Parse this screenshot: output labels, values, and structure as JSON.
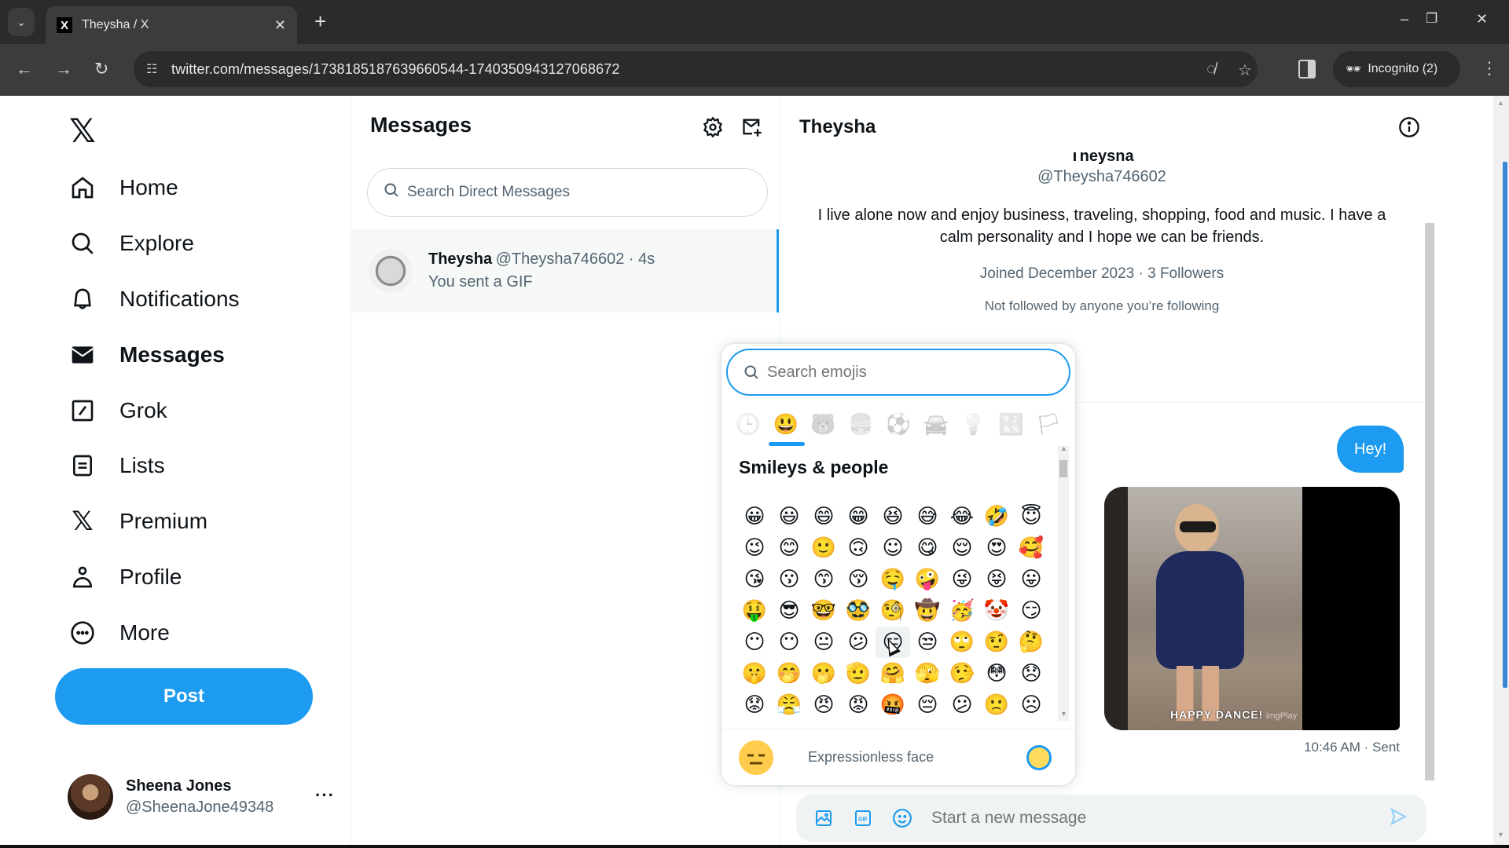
{
  "browser": {
    "tab_title": "Theysha / X",
    "tab_favicon": "X",
    "new_tab": "+",
    "url": "twitter.com/messages/1738185187639660544-1740350943127068672",
    "incognito_label": "Incognito (2)",
    "window_controls": {
      "minimize": "–",
      "restore": "❐",
      "close": "✕"
    }
  },
  "sidebar": {
    "logo": "𝕏",
    "items": [
      {
        "label": "Home",
        "icon": "home-icon"
      },
      {
        "label": "Explore",
        "icon": "search-icon"
      },
      {
        "label": "Notifications",
        "icon": "bell-icon"
      },
      {
        "label": "Messages",
        "icon": "envelope-icon",
        "active": true
      },
      {
        "label": "Grok",
        "icon": "grok-icon"
      },
      {
        "label": "Lists",
        "icon": "list-icon"
      },
      {
        "label": "Premium",
        "icon": "x-logo-icon"
      },
      {
        "label": "Profile",
        "icon": "person-icon"
      },
      {
        "label": "More",
        "icon": "more-circle-icon"
      }
    ],
    "post_label": "Post",
    "account": {
      "name": "Sheena Jones",
      "handle": "@SheenaJone49348",
      "more": "···"
    }
  },
  "conversations": {
    "title": "Messages",
    "search_placeholder": "Search Direct Messages",
    "items": [
      {
        "name": "Theysha",
        "meta": "@Theysha746602 · 4s",
        "preview": "You sent a GIF"
      }
    ]
  },
  "chat": {
    "title": "Theysha",
    "profile": {
      "name": "Theysha",
      "handle": "@Theysha746602",
      "bio": "I live alone now and enjoy business, traveling, shopping, food and music. I have a calm personality and I hope we can be friends.",
      "joined": "Joined December 2023 · 3 Followers",
      "mutual": "Not followed by anyone you’re following"
    },
    "messages": [
      {
        "type": "text",
        "text": "Hey!"
      },
      {
        "type": "gif",
        "caption": "HAPPY DANCE!",
        "watermark": "imgPlay"
      }
    ],
    "status": "10:46 AM · Sent",
    "composer_placeholder": "Start a new message"
  },
  "emoji_picker": {
    "search_placeholder": "Search emojis",
    "categories": [
      {
        "name": "recent",
        "glyph": "🕒"
      },
      {
        "name": "smileys-people",
        "glyph": "😃",
        "active": true
      },
      {
        "name": "animals-nature",
        "glyph": "🐻"
      },
      {
        "name": "food-drink",
        "glyph": "🍔"
      },
      {
        "name": "activity",
        "glyph": "⚽"
      },
      {
        "name": "travel-places",
        "glyph": "🚘"
      },
      {
        "name": "objects",
        "glyph": "💡"
      },
      {
        "name": "symbols",
        "glyph": "🔣"
      },
      {
        "name": "flags",
        "glyph": "🏳"
      }
    ],
    "section_title": "Smileys & people",
    "emojis": [
      "😀",
      "😃",
      "😄",
      "😁",
      "😆",
      "😅",
      "😂",
      "🤣",
      "😇",
      "😉",
      "😊",
      "🙂",
      "🙃",
      "☺",
      "😋",
      "😌",
      "😍",
      "🥰",
      "😘",
      "😗",
      "😙",
      "😚",
      "🤤",
      "🤪",
      "😜",
      "😝",
      "😛",
      "🤑",
      "😎",
      "🤓",
      "🥸",
      "🧐",
      "🤠",
      "🥳",
      "🤡",
      "😏",
      "😶",
      "😶",
      "😐",
      "😕",
      "😑",
      "😒",
      "🙄",
      "🤨",
      "🤔",
      "🤫",
      "🤭",
      "🫢",
      "🫡",
      "🤗",
      "🫣",
      "🤥",
      "😳",
      "😞",
      "😟",
      "😤",
      "😠",
      "😡",
      "🤬",
      "😔",
      "😕",
      "🙁",
      "☹"
    ],
    "hovered_index": 40,
    "preview_glyph": "😑",
    "preview_name": "Expressionless face",
    "skin_tone_color": "#ffdc5d"
  },
  "colors": {
    "accent": "#1d9bf0",
    "text_primary": "#0f1419",
    "text_secondary": "#536471"
  }
}
